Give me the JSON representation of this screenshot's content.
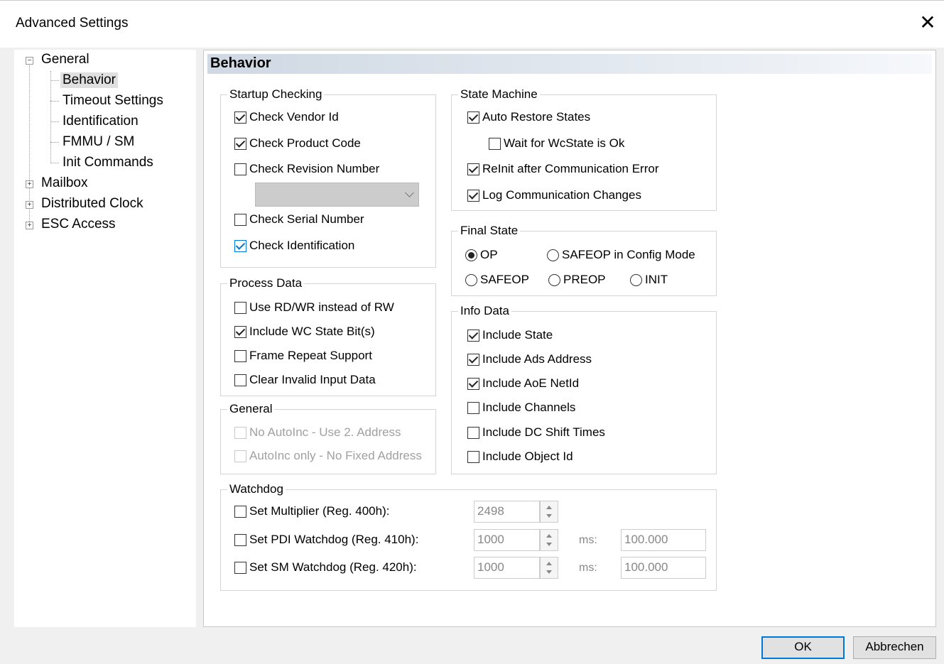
{
  "window": {
    "title": "Advanced Settings",
    "close_glyph": "✕"
  },
  "tree": {
    "items": [
      {
        "label": "General",
        "expander": "−"
      },
      {
        "label": "Behavior"
      },
      {
        "label": "Timeout Settings"
      },
      {
        "label": "Identification"
      },
      {
        "label": "FMMU / SM"
      },
      {
        "label": "Init Commands"
      },
      {
        "label": "Mailbox",
        "expander": "+"
      },
      {
        "label": "Distributed Clock",
        "expander": "+"
      },
      {
        "label": "ESC Access",
        "expander": "+"
      }
    ]
  },
  "panel": {
    "title": "Behavior"
  },
  "startup": {
    "label": "Startup Checking",
    "vendor": "Check Vendor Id",
    "product": "Check Product Code",
    "revision": "Check Revision Number",
    "serial": "Check Serial Number",
    "identification": "Check Identification"
  },
  "process": {
    "label": "Process Data",
    "rdwr": "Use RD/WR instead of RW",
    "wc": "Include WC State Bit(s)",
    "repeat": "Frame Repeat Support",
    "clear": "Clear Invalid Input Data"
  },
  "general": {
    "label": "General",
    "noauto": "No AutoInc - Use 2. Address",
    "autoonly": "AutoInc only - No Fixed Address"
  },
  "state_machine": {
    "label": "State Machine",
    "auto_restore": "Auto Restore States",
    "wait_wc": "Wait for WcState is Ok",
    "reinit": "ReInit after Communication Error",
    "log": "Log Communication Changes"
  },
  "final_state": {
    "label": "Final State",
    "op": "OP",
    "safeop_cfg": "SAFEOP in Config Mode",
    "safeop": "SAFEOP",
    "preop": "PREOP",
    "init": "INIT",
    "selected": "OP"
  },
  "info": {
    "label": "Info Data",
    "state": "Include State",
    "ads": "Include Ads Address",
    "aoe": "Include AoE NetId",
    "channels": "Include Channels",
    "dc": "Include DC Shift Times",
    "objid": "Include Object Id"
  },
  "watchdog": {
    "label": "Watchdog",
    "mult_label": "Set Multiplier (Reg. 400h):",
    "mult_value": "2498",
    "pdi_label": "Set PDI Watchdog (Reg. 410h):",
    "pdi_value": "1000",
    "pdi_ms": "100.000",
    "sm_label": "Set SM Watchdog (Reg. 420h):",
    "sm_value": "1000",
    "sm_ms": "100.000",
    "ms_label": "ms:"
  },
  "buttons": {
    "ok": "OK",
    "cancel": "Abbrechen"
  }
}
